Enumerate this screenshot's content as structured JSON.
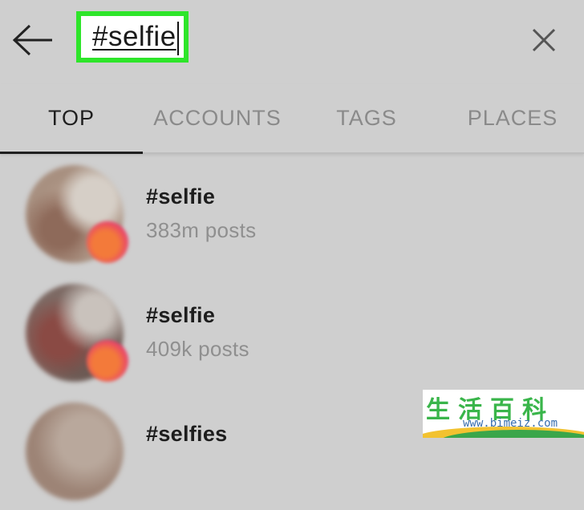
{
  "search": {
    "query": "#selfie"
  },
  "icons": {
    "back": "back-arrow-icon",
    "close": "close-icon",
    "badge": "story-badge-icon"
  },
  "tabs": [
    {
      "label": "TOP",
      "active": true
    },
    {
      "label": "ACCOUNTS",
      "active": false
    },
    {
      "label": "TAGS",
      "active": false
    },
    {
      "label": "PLACES",
      "active": false
    }
  ],
  "results": [
    {
      "title": "#selfie",
      "subtitle": "383m posts"
    },
    {
      "title": "#selfie",
      "subtitle": "409k posts"
    },
    {
      "title": "#selfies",
      "subtitle": ""
    }
  ],
  "watermark": {
    "chars": "生活百科",
    "url": "www.bimeiz.com"
  },
  "colors": {
    "highlight": "#2ee52a",
    "background": "#cfcfcf",
    "badge_gradient": [
      "#f37a3a",
      "#e8436b"
    ]
  }
}
